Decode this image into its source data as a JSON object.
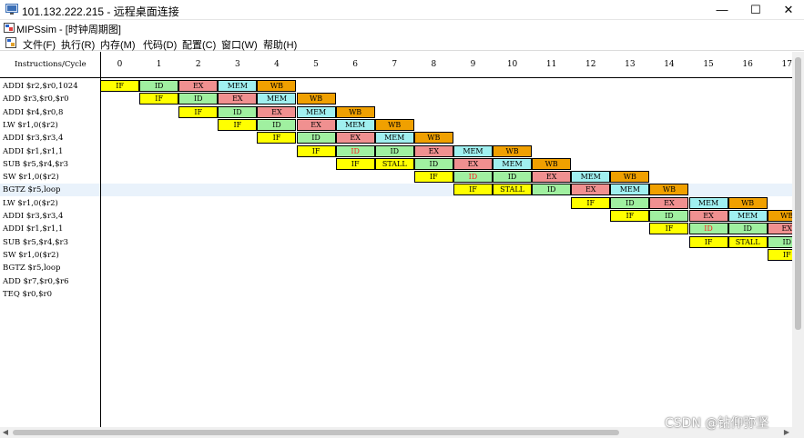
{
  "outer_window": {
    "title": "101.132.222.215 - 远程桌面连接",
    "buttons": {
      "minimize": "—",
      "maximize": "☐",
      "close": "✕"
    }
  },
  "inner_window": {
    "title": "MIPSsim - [时钟周期图]"
  },
  "menu": {
    "items": [
      "文件(F)",
      "执行(R)",
      "内存(M)",
      "代码(D)",
      "配置(C)",
      "窗口(W)",
      "帮助(H)"
    ]
  },
  "diagram": {
    "header_label": "Instructions/Cycle",
    "cycles": [
      "0",
      "1",
      "2",
      "3",
      "4",
      "5",
      "6",
      "7",
      "8",
      "9",
      "10",
      "11",
      "12",
      "13",
      "14",
      "15",
      "16",
      "17"
    ],
    "highlighted_row": 8,
    "instructions": [
      "ADDI $r2,$r0,1024",
      "ADD $r3,$r0,$r0",
      "ADDI $r4,$r0,8",
      "LW $r1,0($r2)",
      "ADDI $r3,$r3,4",
      "ADDI $r1,$r1,1",
      "SUB $r5,$r4,$r3",
      "SW $r1,0($r2)",
      "BGTZ $r5,loop",
      "LW $r1,0($r2)",
      "ADDI $r3,$r3,4",
      "ADDI $r1,$r1,1",
      "SUB $r5,$r4,$r3",
      "SW $r1,0($r2)",
      "BGTZ $r5,loop",
      "ADD $r7,$r0,$r6",
      "TEQ $r0,$r0"
    ],
    "stages": [
      {
        "row": 0,
        "cycle": 0,
        "label": "IF",
        "kind": "if"
      },
      {
        "row": 0,
        "cycle": 1,
        "label": "ID",
        "kind": "id"
      },
      {
        "row": 0,
        "cycle": 2,
        "label": "EX",
        "kind": "ex"
      },
      {
        "row": 0,
        "cycle": 3,
        "label": "MEM",
        "kind": "mem"
      },
      {
        "row": 0,
        "cycle": 4,
        "label": "WB",
        "kind": "wb"
      },
      {
        "row": 1,
        "cycle": 1,
        "label": "IF",
        "kind": "if"
      },
      {
        "row": 1,
        "cycle": 2,
        "label": "ID",
        "kind": "id"
      },
      {
        "row": 1,
        "cycle": 3,
        "label": "EX",
        "kind": "ex"
      },
      {
        "row": 1,
        "cycle": 4,
        "label": "MEM",
        "kind": "mem"
      },
      {
        "row": 1,
        "cycle": 5,
        "label": "WB",
        "kind": "wb"
      },
      {
        "row": 2,
        "cycle": 2,
        "label": "IF",
        "kind": "if"
      },
      {
        "row": 2,
        "cycle": 3,
        "label": "ID",
        "kind": "id"
      },
      {
        "row": 2,
        "cycle": 4,
        "label": "EX",
        "kind": "ex"
      },
      {
        "row": 2,
        "cycle": 5,
        "label": "MEM",
        "kind": "mem"
      },
      {
        "row": 2,
        "cycle": 6,
        "label": "WB",
        "kind": "wb"
      },
      {
        "row": 3,
        "cycle": 3,
        "label": "IF",
        "kind": "if"
      },
      {
        "row": 3,
        "cycle": 4,
        "label": "ID",
        "kind": "id"
      },
      {
        "row": 3,
        "cycle": 5,
        "label": "EX",
        "kind": "ex"
      },
      {
        "row": 3,
        "cycle": 6,
        "label": "MEM",
        "kind": "mem"
      },
      {
        "row": 3,
        "cycle": 7,
        "label": "WB",
        "kind": "wb"
      },
      {
        "row": 4,
        "cycle": 4,
        "label": "IF",
        "kind": "if"
      },
      {
        "row": 4,
        "cycle": 5,
        "label": "ID",
        "kind": "id"
      },
      {
        "row": 4,
        "cycle": 6,
        "label": "EX",
        "kind": "ex"
      },
      {
        "row": 4,
        "cycle": 7,
        "label": "MEM",
        "kind": "mem"
      },
      {
        "row": 4,
        "cycle": 8,
        "label": "WB",
        "kind": "wb"
      },
      {
        "row": 5,
        "cycle": 5,
        "label": "IF",
        "kind": "if"
      },
      {
        "row": 5,
        "cycle": 6,
        "label": "ID",
        "kind": "id",
        "warn": true
      },
      {
        "row": 5,
        "cycle": 7,
        "label": "ID",
        "kind": "id"
      },
      {
        "row": 5,
        "cycle": 8,
        "label": "EX",
        "kind": "ex"
      },
      {
        "row": 5,
        "cycle": 9,
        "label": "MEM",
        "kind": "mem"
      },
      {
        "row": 5,
        "cycle": 10,
        "label": "WB",
        "kind": "wb"
      },
      {
        "row": 6,
        "cycle": 6,
        "label": "IF",
        "kind": "if"
      },
      {
        "row": 6,
        "cycle": 7,
        "label": "STALL",
        "kind": "stall"
      },
      {
        "row": 6,
        "cycle": 8,
        "label": "ID",
        "kind": "id"
      },
      {
        "row": 6,
        "cycle": 9,
        "label": "EX",
        "kind": "ex"
      },
      {
        "row": 6,
        "cycle": 10,
        "label": "MEM",
        "kind": "mem"
      },
      {
        "row": 6,
        "cycle": 11,
        "label": "WB",
        "kind": "wb"
      },
      {
        "row": 7,
        "cycle": 8,
        "label": "IF",
        "kind": "if"
      },
      {
        "row": 7,
        "cycle": 9,
        "label": "ID",
        "kind": "id",
        "warn": true
      },
      {
        "row": 7,
        "cycle": 10,
        "label": "ID",
        "kind": "id"
      },
      {
        "row": 7,
        "cycle": 11,
        "label": "EX",
        "kind": "ex"
      },
      {
        "row": 7,
        "cycle": 12,
        "label": "MEM",
        "kind": "mem"
      },
      {
        "row": 7,
        "cycle": 13,
        "label": "WB",
        "kind": "wb"
      },
      {
        "row": 8,
        "cycle": 9,
        "label": "IF",
        "kind": "if"
      },
      {
        "row": 8,
        "cycle": 10,
        "label": "STALL",
        "kind": "stall"
      },
      {
        "row": 8,
        "cycle": 11,
        "label": "ID",
        "kind": "id"
      },
      {
        "row": 8,
        "cycle": 12,
        "label": "EX",
        "kind": "ex"
      },
      {
        "row": 8,
        "cycle": 13,
        "label": "MEM",
        "kind": "mem"
      },
      {
        "row": 8,
        "cycle": 14,
        "label": "WB",
        "kind": "wb"
      },
      {
        "row": 9,
        "cycle": 12,
        "label": "IF",
        "kind": "if"
      },
      {
        "row": 9,
        "cycle": 13,
        "label": "ID",
        "kind": "id"
      },
      {
        "row": 9,
        "cycle": 14,
        "label": "EX",
        "kind": "ex"
      },
      {
        "row": 9,
        "cycle": 15,
        "label": "MEM",
        "kind": "mem"
      },
      {
        "row": 9,
        "cycle": 16,
        "label": "WB",
        "kind": "wb"
      },
      {
        "row": 10,
        "cycle": 13,
        "label": "IF",
        "kind": "if"
      },
      {
        "row": 10,
        "cycle": 14,
        "label": "ID",
        "kind": "id"
      },
      {
        "row": 10,
        "cycle": 15,
        "label": "EX",
        "kind": "ex"
      },
      {
        "row": 10,
        "cycle": 16,
        "label": "MEM",
        "kind": "mem"
      },
      {
        "row": 10,
        "cycle": 17,
        "label": "WB",
        "kind": "wb"
      },
      {
        "row": 11,
        "cycle": 14,
        "label": "IF",
        "kind": "if"
      },
      {
        "row": 11,
        "cycle": 15,
        "label": "ID",
        "kind": "id",
        "warn": true
      },
      {
        "row": 11,
        "cycle": 16,
        "label": "ID",
        "kind": "id"
      },
      {
        "row": 11,
        "cycle": 17,
        "label": "EX",
        "kind": "ex"
      },
      {
        "row": 12,
        "cycle": 15,
        "label": "IF",
        "kind": "if"
      },
      {
        "row": 12,
        "cycle": 16,
        "label": "STALL",
        "kind": "stall"
      },
      {
        "row": 12,
        "cycle": 17,
        "label": "ID",
        "kind": "id"
      },
      {
        "row": 13,
        "cycle": 17,
        "label": "IF",
        "kind": "if"
      }
    ]
  },
  "watermark": "CSDN @钻仰弥坚"
}
